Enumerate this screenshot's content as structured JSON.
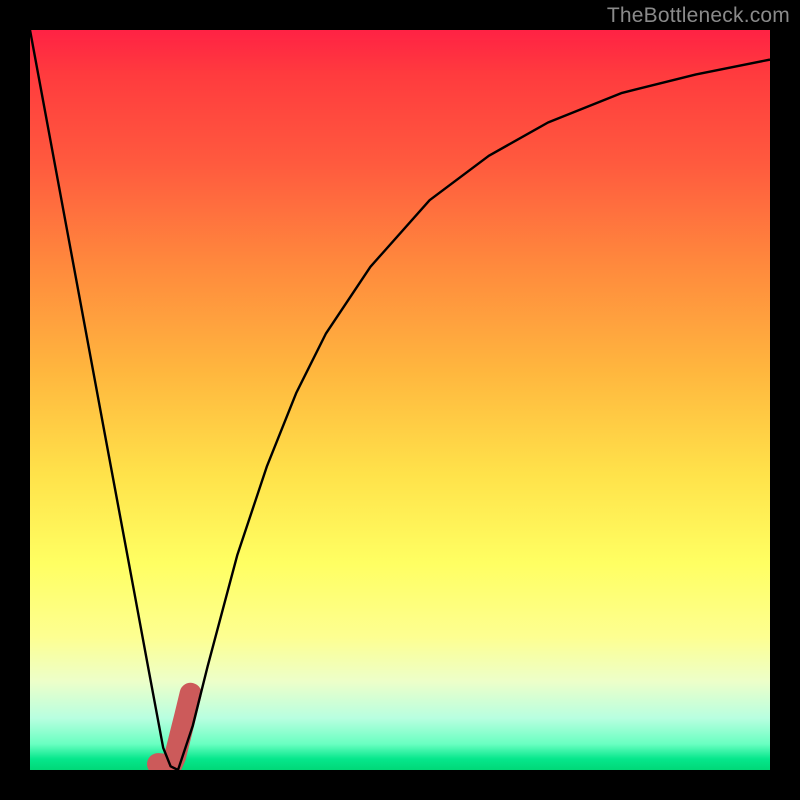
{
  "watermark": {
    "text": "TheBottleneck.com"
  },
  "chart_data": {
    "type": "line",
    "title": "",
    "xlabel": "",
    "ylabel": "",
    "xlim": [
      0,
      100
    ],
    "ylim": [
      0,
      100
    ],
    "series": [
      {
        "name": "bottleneck-curve",
        "x": [
          0,
          5,
          10,
          14,
          16,
          18,
          19,
          20,
          22,
          24,
          28,
          32,
          36,
          40,
          46,
          54,
          62,
          70,
          80,
          90,
          100
        ],
        "values": [
          100,
          73,
          46,
          24.5,
          13.7,
          3,
          0.5,
          0,
          6,
          14,
          29,
          41,
          51,
          59,
          68,
          77,
          83,
          87.5,
          91.5,
          94,
          96
        ]
      }
    ],
    "marker": {
      "name": "highlight-range",
      "x": [
        17.3,
        18.4,
        19.1,
        19.6,
        20.3,
        21.0,
        21.7
      ],
      "values": [
        0.8,
        0.7,
        0.7,
        1.8,
        4.6,
        7.4,
        10.3
      ],
      "color": "#cc5a5a",
      "width": 22
    },
    "background_gradient": {
      "top_color": "#ff2244",
      "mid_color": "#ffff62",
      "bottom_color": "#01d877"
    }
  }
}
